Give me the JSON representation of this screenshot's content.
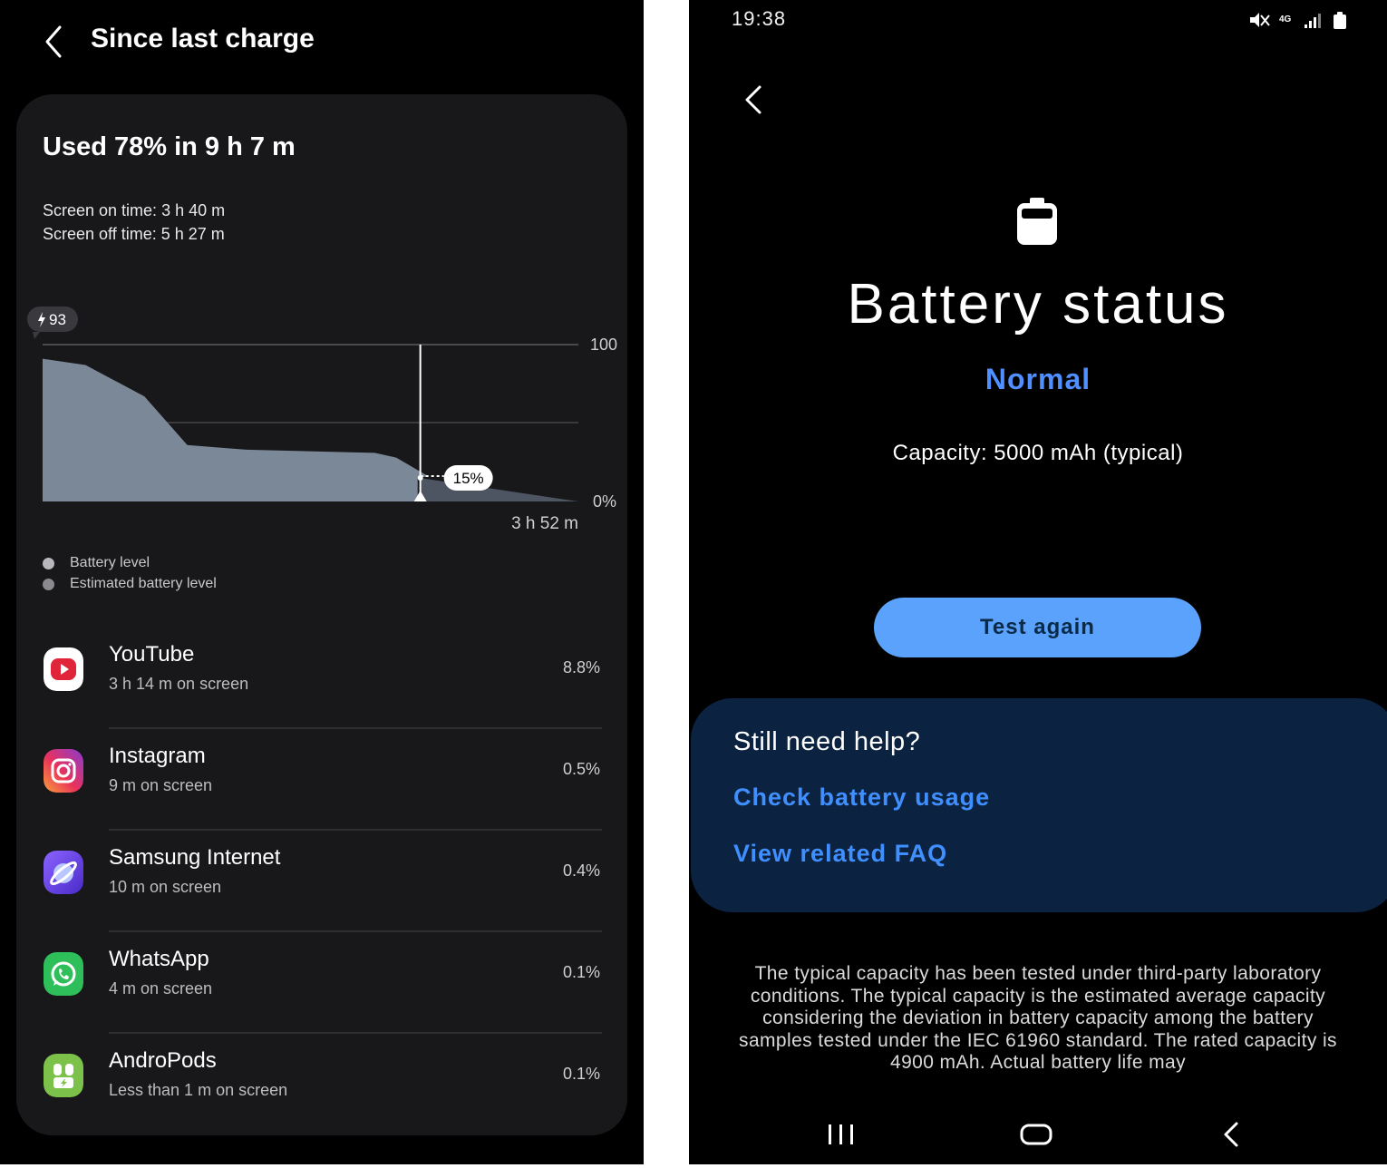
{
  "left": {
    "title": "Since last charge",
    "headline": "Used 78% in 9 h 7 m",
    "screen_on": "Screen on time: 3 h 40 m",
    "screen_off": "Screen off time: 5 h 27 m",
    "chart_data": {
      "type": "area",
      "charge_marker": "93",
      "y_labels": [
        "100",
        "0%"
      ],
      "ylim": [
        0,
        100
      ],
      "grid": true,
      "x_end_label": "3 h 52 m",
      "current_label": "15%",
      "battery_level": [
        [
          0,
          91
        ],
        [
          0.08,
          87
        ],
        [
          0.19,
          67
        ],
        [
          0.27,
          36
        ],
        [
          0.38,
          33
        ],
        [
          0.62,
          31
        ],
        [
          0.66,
          28
        ],
        [
          0.72,
          16
        ],
        [
          0.7,
          15
        ]
      ],
      "estimated_level": [
        [
          0.705,
          15
        ],
        [
          1.0,
          0
        ]
      ],
      "legend": [
        "Battery level",
        "Estimated battery level"
      ],
      "colors": {
        "battery": "#7b8897",
        "estimated": "#4d5562"
      }
    },
    "apps": [
      {
        "name": "YouTube",
        "sub": "3 h 14 m on screen",
        "pct": "8.8%",
        "icon": "youtube-icon"
      },
      {
        "name": "Instagram",
        "sub": "9 m on screen",
        "pct": "0.5%",
        "icon": "instagram-icon"
      },
      {
        "name": "Samsung Internet",
        "sub": "10 m on screen",
        "pct": "0.4%",
        "icon": "samsung-internet-icon"
      },
      {
        "name": "WhatsApp",
        "sub": "4 m on screen",
        "pct": "0.1%",
        "icon": "whatsapp-icon"
      },
      {
        "name": "AndroPods",
        "sub": "Less than 1 m on screen",
        "pct": "0.1%",
        "icon": "andropods-icon"
      }
    ]
  },
  "right": {
    "time": "19:38",
    "network": "4G",
    "title": "Battery status",
    "status": "Normal",
    "capacity": "Capacity: 5000 mAh (typical)",
    "test_button": "Test again",
    "help_title": "Still need help?",
    "help_links": [
      "Check battery usage",
      "View related FAQ"
    ],
    "footnote": "The typical capacity has been tested under third-party laboratory conditions. The typical capacity is the estimated average capacity considering the deviation in battery capacity among the battery samples tested under the IEC 61960 standard. The rated capacity is 4900 mAh. Actual battery life may",
    "colors": {
      "accent": "#4f8fff",
      "button": "#5aa2fb",
      "card": "#0b2240"
    }
  }
}
